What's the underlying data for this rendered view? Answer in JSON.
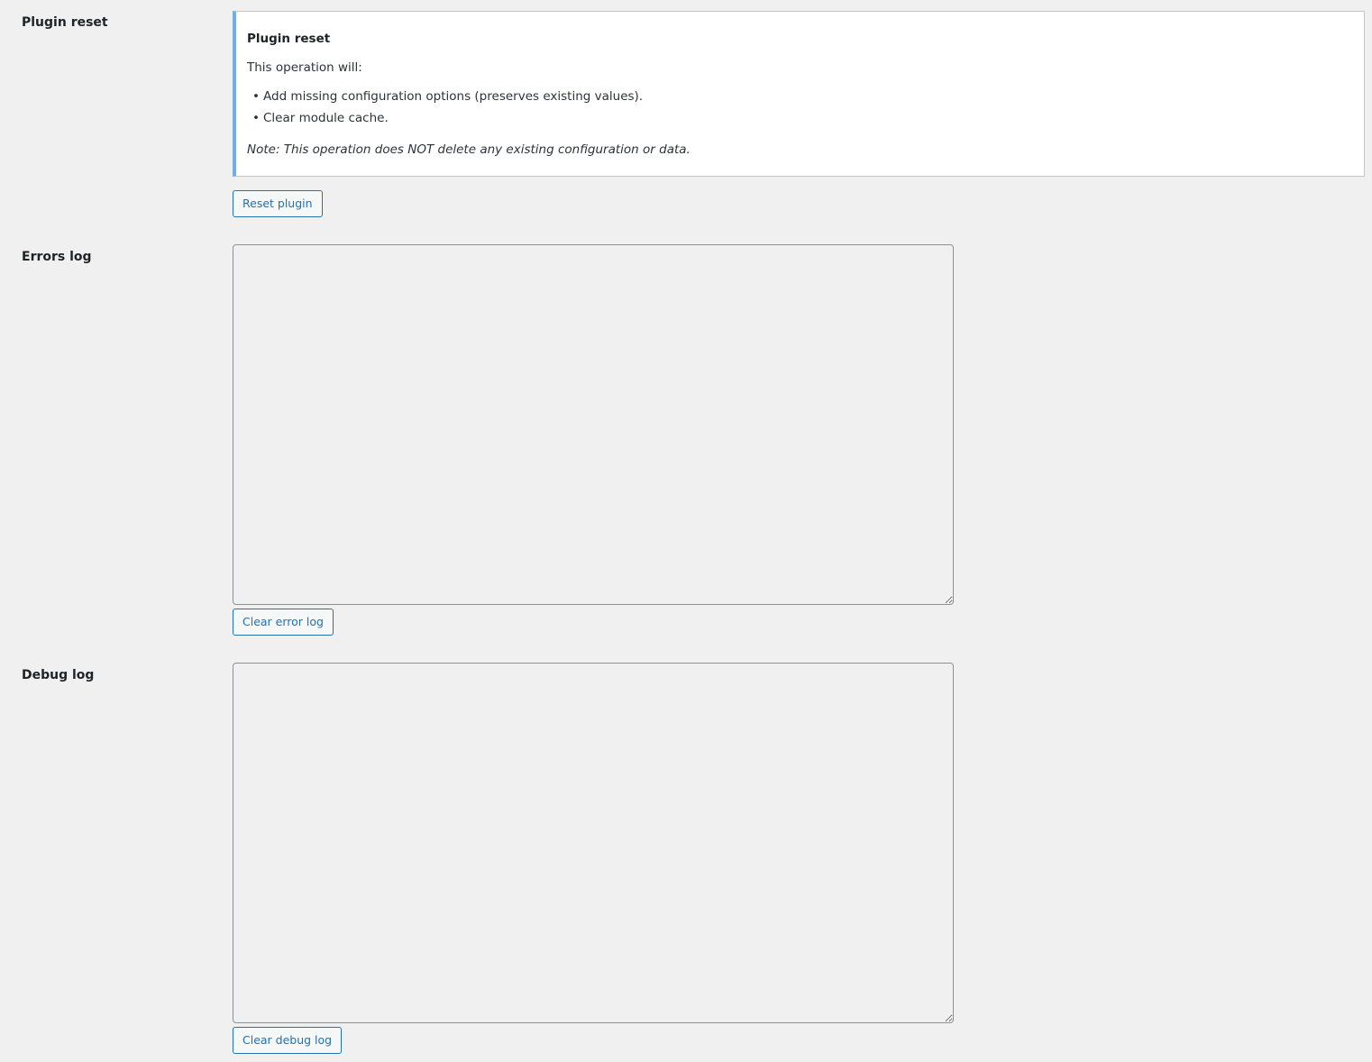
{
  "plugin_reset": {
    "label": "Plugin reset",
    "notice": {
      "title": "Plugin reset",
      "intro": "This operation will:",
      "items": [
        "Add missing configuration options (preserves existing values).",
        "Clear module cache."
      ],
      "note": "Note: This operation does NOT delete any existing configuration or data."
    },
    "button_label": "Reset plugin"
  },
  "errors_log": {
    "label": "Errors log",
    "value": "",
    "button_label": "Clear error log"
  },
  "debug_log": {
    "label": "Debug log",
    "value": "",
    "button_label": "Clear debug log"
  },
  "colors": {
    "background": "#f0f0f1",
    "accent": "#2271b1",
    "notice_border": "#72aee6"
  }
}
